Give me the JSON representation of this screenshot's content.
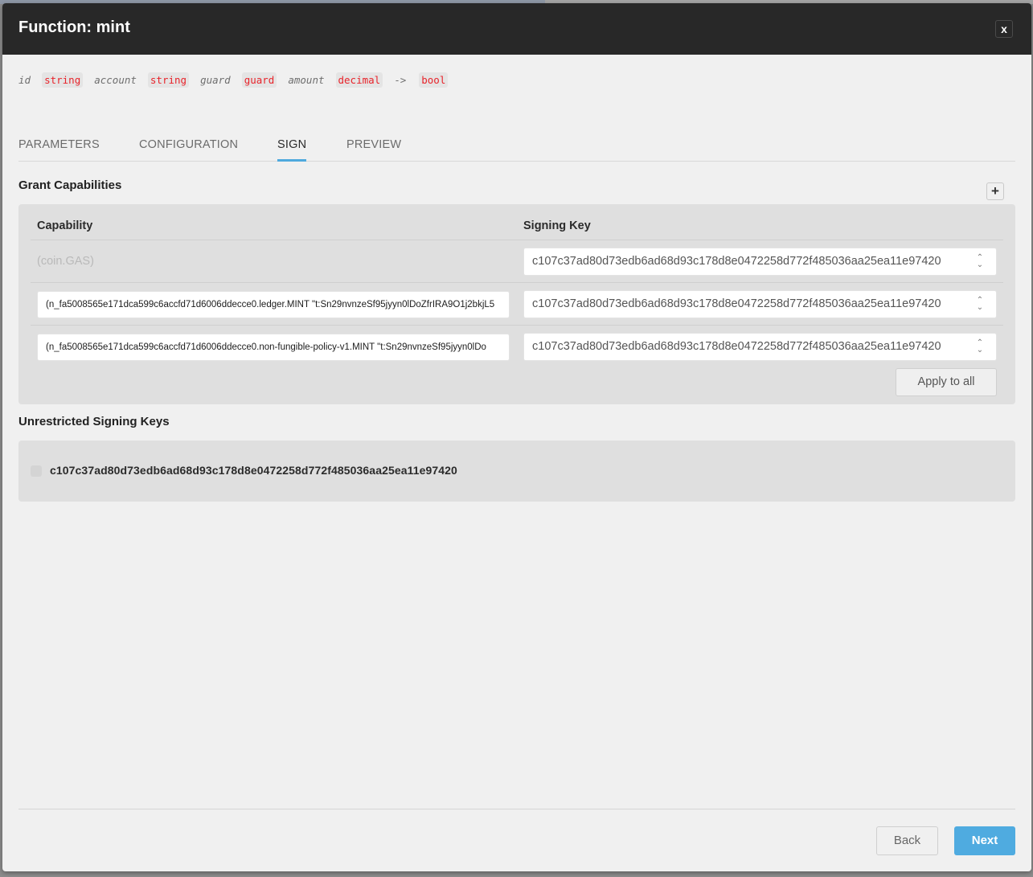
{
  "modal": {
    "title": "Function: mint",
    "close_label": "x"
  },
  "signature": {
    "params": [
      {
        "name": "id",
        "type": "string"
      },
      {
        "name": "account",
        "type": "string"
      },
      {
        "name": "guard",
        "type": "guard"
      },
      {
        "name": "amount",
        "type": "decimal"
      }
    ],
    "arrow": "->",
    "return_type": "bool"
  },
  "tabs": [
    {
      "label": "PARAMETERS",
      "active": false
    },
    {
      "label": "CONFIGURATION",
      "active": false
    },
    {
      "label": "SIGN",
      "active": true
    },
    {
      "label": "PREVIEW",
      "active": false
    }
  ],
  "grant_capabilities": {
    "title": "Grant Capabilities",
    "add_label": "+",
    "columns": {
      "capability": "Capability",
      "signing_key": "Signing Key"
    },
    "rows": [
      {
        "capability": "(coin.GAS)",
        "editable": false,
        "signing_key": "c107c37ad80d73edb6ad68d93c178d8e0472258d772f485036aa25ea11e97420"
      },
      {
        "capability": "(n_fa5008565e171dca599c6accfd71d6006ddecce0.ledger.MINT \"t:Sn29nvnzeSf95jyyn0lDoZfrIRA9O1j2bkjL5",
        "editable": true,
        "signing_key": "c107c37ad80d73edb6ad68d93c178d8e0472258d772f485036aa25ea11e97420"
      },
      {
        "capability": "(n_fa5008565e171dca599c6accfd71d6006ddecce0.non-fungible-policy-v1.MINT \"t:Sn29nvnzeSf95jyyn0lDo",
        "editable": true,
        "signing_key": "c107c37ad80d73edb6ad68d93c178d8e0472258d772f485036aa25ea11e97420"
      }
    ],
    "apply_all_label": "Apply to all"
  },
  "unrestricted": {
    "title": "Unrestricted Signing Keys",
    "keys": [
      {
        "key": "c107c37ad80d73edb6ad68d93c178d8e0472258d772f485036aa25ea11e97420",
        "checked": false
      }
    ]
  },
  "footer": {
    "back_label": "Back",
    "next_label": "Next"
  },
  "colors": {
    "accent": "#4fabe0",
    "type_text": "#e8232a",
    "header_bg": "#282828"
  }
}
